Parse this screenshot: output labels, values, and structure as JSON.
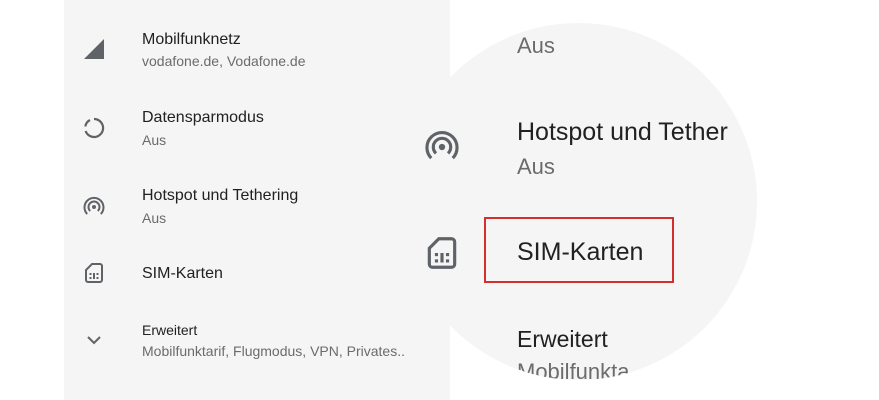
{
  "settings": {
    "items": [
      {
        "title": "Mobilfunknetz",
        "subtitle": "vodafone.de, Vodafone.de",
        "icon": "signal-icon"
      },
      {
        "title": "Datensparmodus",
        "subtitle": "Aus",
        "icon": "data-saver-icon"
      },
      {
        "title": "Hotspot und Tethering",
        "subtitle": "Aus",
        "icon": "hotspot-icon"
      },
      {
        "title": "SIM-Karten",
        "icon": "sim-card-icon"
      },
      {
        "title": "Erweitert",
        "subtitle": "Mobilfunktarif, Flugmodus, VPN, Privates..",
        "icon": "chevron-down-icon"
      }
    ]
  },
  "zoom": {
    "top_sub": "Aus",
    "hotspot_title": "Hotspot und Tether",
    "hotspot_sub": "Aus",
    "sim_title": "SIM-Karten",
    "erweitert_title": "Erweitert",
    "erweitert_sub": "Mobilfunkta"
  },
  "colors": {
    "panel_bg": "#f5f5f5",
    "icon": "#5f6368",
    "highlight": "#d32f2f"
  }
}
